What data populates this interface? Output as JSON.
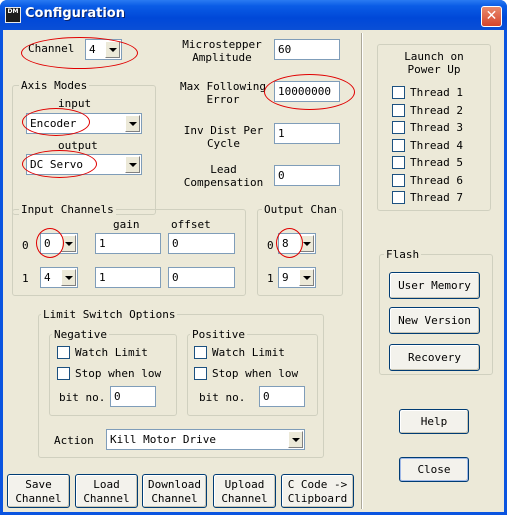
{
  "window": {
    "title": "Configuration",
    "icon_text": "DM"
  },
  "channel": {
    "label": "Channel",
    "value": "4"
  },
  "microstepper": {
    "label_line1": "Microstepper",
    "label_line2": "Amplitude",
    "value": "60"
  },
  "max_following": {
    "label_line1": "Max Following",
    "label_line2": "Error",
    "value": "10000000"
  },
  "inv_dist": {
    "label_line1": "Inv Dist Per",
    "label_line2": "Cycle",
    "value": "1"
  },
  "lead_comp": {
    "label_line1": "Lead",
    "label_line2": "Compensation",
    "value": "0"
  },
  "axis_modes": {
    "title": "Axis Modes",
    "input_label": "input",
    "input_value": "Encoder",
    "output_label": "output",
    "output_value": "DC Servo"
  },
  "input_channels": {
    "title": "Input Channels",
    "gain_header": "gain",
    "offset_header": "offset",
    "rows": [
      {
        "index": "0",
        "channel": "0",
        "gain": "1",
        "offset": "0"
      },
      {
        "index": "1",
        "channel": "4",
        "gain": "1",
        "offset": "0"
      }
    ]
  },
  "output_channels": {
    "title": "Output Chan",
    "rows": [
      {
        "index": "0",
        "channel": "8"
      },
      {
        "index": "1",
        "channel": "9"
      }
    ]
  },
  "limit_switch": {
    "title": "Limit Switch Options",
    "negative": {
      "title": "Negative",
      "watch": "Watch Limit",
      "stop": "Stop when low",
      "bit_label": "bit no.",
      "bit_value": "0"
    },
    "positive": {
      "title": "Positive",
      "watch": "Watch Limit",
      "stop": "Stop when low",
      "bit_label": "bit no.",
      "bit_value": "0"
    },
    "action_label": "Action",
    "action_value": "Kill Motor Drive"
  },
  "launch": {
    "title_line1": "Launch on",
    "title_line2": "Power Up",
    "threads": [
      "Thread 1",
      "Thread 2",
      "Thread 3",
      "Thread 4",
      "Thread 5",
      "Thread 6",
      "Thread 7"
    ]
  },
  "flash": {
    "title": "Flash",
    "user_memory": "User Memory",
    "new_version": "New Version",
    "recovery": "Recovery"
  },
  "buttons": {
    "help": "Help",
    "close": "Close",
    "save_1": "Save",
    "save_2": "Channel",
    "load_1": "Load",
    "load_2": "Channel",
    "download_1": "Download",
    "download_2": "Channel",
    "upload_1": "Upload",
    "upload_2": "Channel",
    "ccode_1": "C Code ->",
    "ccode_2": "Clipboard"
  },
  "colors": {
    "titlebar": "#0a54e0",
    "client": "#ece9d8",
    "highlight_ellipse": "#e00000"
  }
}
